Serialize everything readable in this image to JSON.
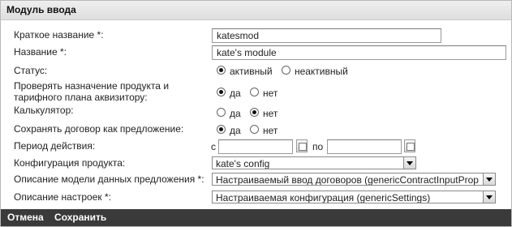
{
  "header": {
    "title": "Модуль ввода"
  },
  "fields": {
    "short_name": {
      "label": "Краткое название *:",
      "value": "katesmod"
    },
    "name": {
      "label": "Название *:",
      "value": "kate's module"
    },
    "status": {
      "label": "Статус:",
      "opt1": "активный",
      "opt2": "неактивный",
      "selected": "активный"
    },
    "check_product": {
      "label_line1": "Проверять назначение продукта и",
      "label_line2": "тарифного плана аквизитору:",
      "opt1": "да",
      "opt2": "нет",
      "selected": "да"
    },
    "calculator": {
      "label": "Калькулятор:",
      "opt1": "да",
      "opt2": "нет",
      "selected": "нет"
    },
    "save_as_offer": {
      "label": "Сохранять договор как предложение:",
      "opt1": "да",
      "opt2": "нет",
      "selected": "да"
    },
    "period": {
      "label": "Период действия:",
      "from_label": "с",
      "to_label": "по",
      "from_value": "",
      "to_value": ""
    },
    "product_config": {
      "label": "Конфигурация продукта:",
      "value": "kate's config"
    },
    "offer_model": {
      "label": "Описание модели данных предложения *:",
      "value": "Настраиваемый ввод договоров (genericContractInputProp"
    },
    "settings_desc": {
      "label": "Описание настроек *:",
      "value": "Настраиваемая конфигурация (genericSettings)"
    }
  },
  "footer": {
    "cancel": "Отмена",
    "save": "Сохранить"
  }
}
